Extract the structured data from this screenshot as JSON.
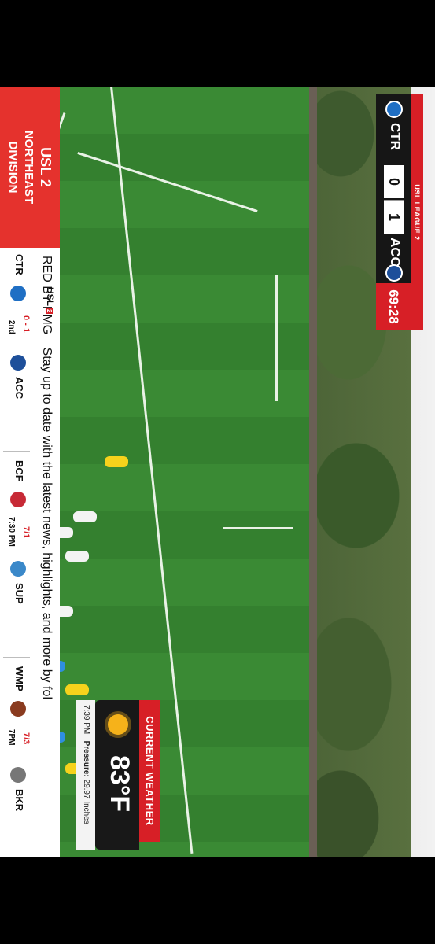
{
  "scorebug": {
    "league": "USL LEAGUE 2",
    "home_team": "CTR",
    "home_score": "0",
    "away_score": "1",
    "away_team": "ACC",
    "clock": "69:28"
  },
  "weather": {
    "header": "CURRENT WEATHER",
    "icon": "sun-icon",
    "temperature": "83°F",
    "time": "7:39 PM",
    "pressure_label": "Pressure:",
    "pressure_value": "29.97 Inches"
  },
  "ticker": {
    "division_line1": "USL 2",
    "division_line2": "NORTHEAST",
    "division_line3": "DIVISION",
    "news_prefix": "RED BY PMG",
    "news_text": "Stay up to date with the latest news, highlights, and more by fol",
    "league_logo": "USL",
    "league_logo_badge": "2",
    "games": [
      {
        "home": "CTR",
        "result": "0 - 1",
        "status": "2nd",
        "away": "ACC"
      },
      {
        "home": "BCF",
        "result": "7/1",
        "status": "7:30 PM",
        "away": "SUP"
      },
      {
        "home": "WMP",
        "result": "7/3",
        "status": "7PM",
        "away": "BKR"
      }
    ]
  },
  "colors": {
    "accent_red": "#d71f26",
    "dark": "#161616",
    "field_green": "#3a8a34"
  }
}
